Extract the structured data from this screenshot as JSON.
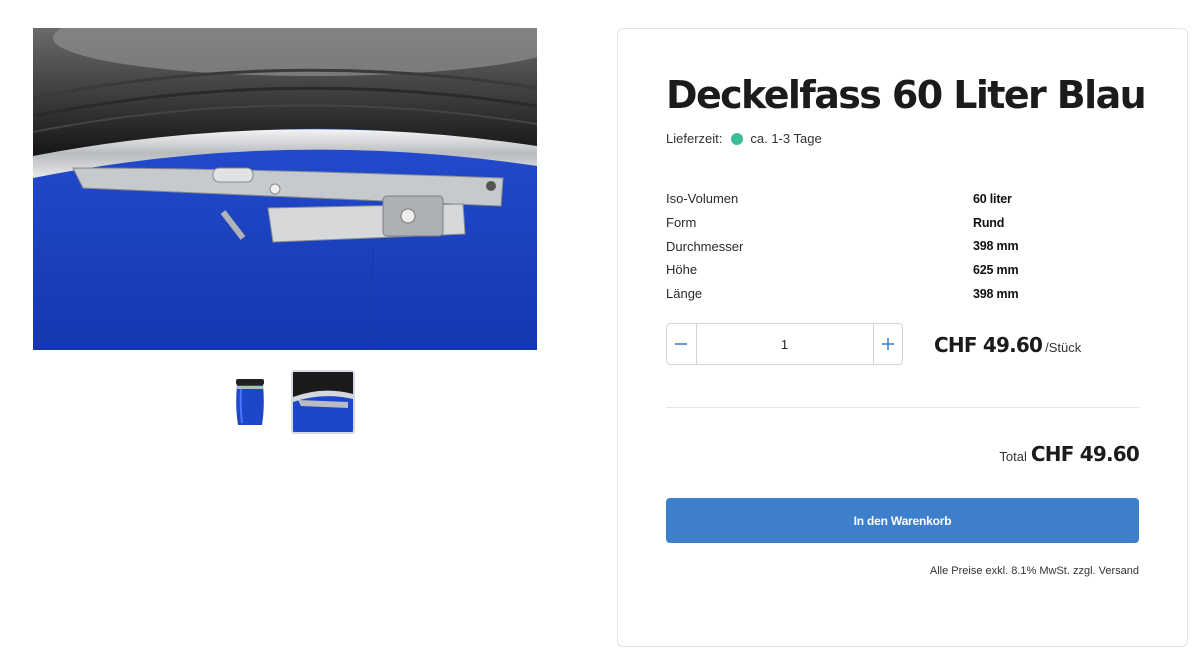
{
  "product": {
    "title": "Deckelfass 60 Liter Blau",
    "delivery_label": "Lieferzeit:",
    "delivery_value": "ca. 1-3 Tage",
    "delivery_status_color": "#3cbc96"
  },
  "gallery": {
    "main_image": "blue-barrel-lid-clamp-closeup",
    "thumbnails": [
      {
        "image": "blue-barrel-full-view",
        "active": false
      },
      {
        "image": "blue-barrel-lid-clamp-closeup",
        "active": true
      }
    ]
  },
  "specs": [
    {
      "label": "Iso-Volumen",
      "value": "60 liter"
    },
    {
      "label": "Form",
      "value": "Rund"
    },
    {
      "label": "Durchmesser",
      "value": "398 mm"
    },
    {
      "label": "Höhe",
      "value": "625 mm"
    },
    {
      "label": "Länge",
      "value": "398 mm"
    }
  ],
  "quantity": {
    "value": "1",
    "minus_icon": "minus-icon",
    "plus_icon": "plus-icon"
  },
  "pricing": {
    "unit_price": "CHF 49.60",
    "unit_suffix": "/Stück",
    "total_label": "Total",
    "total_price": "CHF 49.60"
  },
  "cart": {
    "button_label": "In den Warenkorb",
    "vat_note": "Alle Preise exkl. 8.1% MwSt. zzgl. Versand"
  },
  "colors": {
    "accent": "#3d7fcb",
    "barrel_blue": "#1e46c8"
  }
}
